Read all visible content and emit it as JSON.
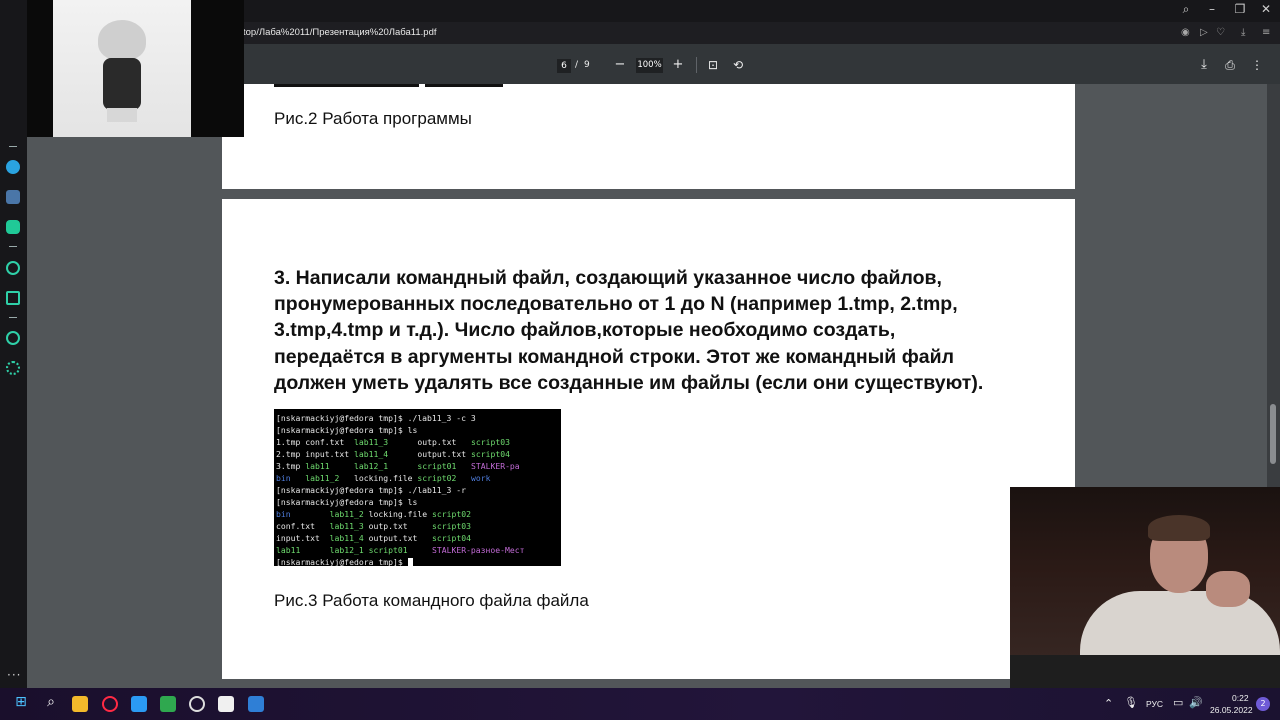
{
  "browser": {
    "address": "top/Лаба%2011/Презентация%20Лаба11.pdf",
    "window_controls": [
      "search-icon",
      "minimize-icon",
      "restore-icon",
      "close-icon"
    ]
  },
  "pdf_toolbar": {
    "current_page": "6",
    "separator": "/",
    "total_pages": "9",
    "zoom": "100%",
    "zoom_out": "−",
    "zoom_in": "+"
  },
  "page_top": {
    "caption": "Рис.2 Работа программы"
  },
  "page_main": {
    "paragraph": [
      "3. Написали командный файл, создающий указанное число файлов,",
      "пронумерованных последовательно от 1 до N (например 1.tmp, 2.tmp,",
      "3.tmp,4.tmp и т.д.). Число файлов,которые необходимо создать,",
      "передаётся в аргументы командной строки. Этот же командный файл",
      "должен уметь удалять все созданные им файлы (если они существуют)."
    ],
    "terminal": {
      "prompt1": "[nskarmackiyj@fedora tmp]$ ./lab11_3 -c 3",
      "prompt2": "[nskarmackiyj@fedora tmp]$ ls",
      "ls1": [
        [
          "1.tmp",
          "conf.txt",
          "lab11_3",
          "outp.txt",
          "script03"
        ],
        [
          "2.tmp",
          "input.txt",
          "lab11_4",
          "output.txt",
          "script04"
        ],
        [
          "3.tmp",
          "lab11",
          "lab12_1",
          "script01",
          "STALKER-ра"
        ],
        [
          "bin",
          "lab11_2",
          "locking.file",
          "script02",
          "work"
        ]
      ],
      "prompt3": "[nskarmackiyj@fedora tmp]$ ./lab11_3 -r",
      "prompt4": "[nskarmackiyj@fedora tmp]$ ls",
      "ls2": [
        [
          "bin",
          "lab11_2",
          "locking.file",
          "script02"
        ],
        [
          "conf.txt",
          "lab11_3",
          "outp.txt",
          "script03"
        ],
        [
          "input.txt",
          "lab11_4",
          "output.txt",
          "script04"
        ],
        [
          "lab11",
          "lab12_1",
          "script01",
          "STALKER-разное-Мест"
        ]
      ],
      "prompt5": "[nskarmackiyj@fedora tmp]$ "
    },
    "caption": "Рис.3 Работа командного файла файла"
  },
  "taskbar": {
    "lang": "РУС",
    "time": "0:22",
    "date": "26.05.2022",
    "notifications": "2"
  }
}
